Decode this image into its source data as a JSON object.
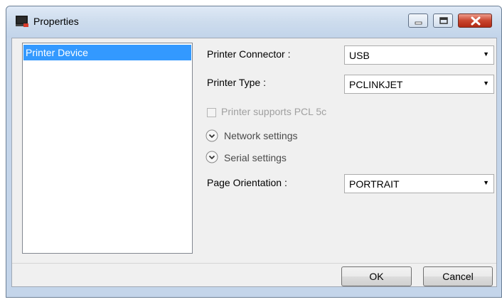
{
  "window": {
    "title": "Properties",
    "icons": {
      "app": "printer-window-icon",
      "minimize": "minimize-icon",
      "maximize": "maximize-icon",
      "close": "close-icon"
    }
  },
  "sidebar": {
    "items": [
      {
        "label": "Printer Device",
        "selected": true
      }
    ]
  },
  "form": {
    "connector": {
      "label": "Printer Connector  :",
      "value": "USB"
    },
    "type": {
      "label": "Printer Type :",
      "value": "PCLINKJET"
    },
    "pcl5c": {
      "label": "Printer supports PCL 5c",
      "checked": false,
      "enabled": false
    },
    "network": {
      "label": "Network settings"
    },
    "serial": {
      "label": "Serial settings"
    },
    "orientation": {
      "label": "Page Orientation :",
      "value": "PORTRAIT"
    }
  },
  "buttons": {
    "ok": "OK",
    "cancel": "Cancel"
  },
  "colors": {
    "selection": "#3399ff",
    "close_button": "#c9462f",
    "disabled_text": "#a0a0a0"
  }
}
